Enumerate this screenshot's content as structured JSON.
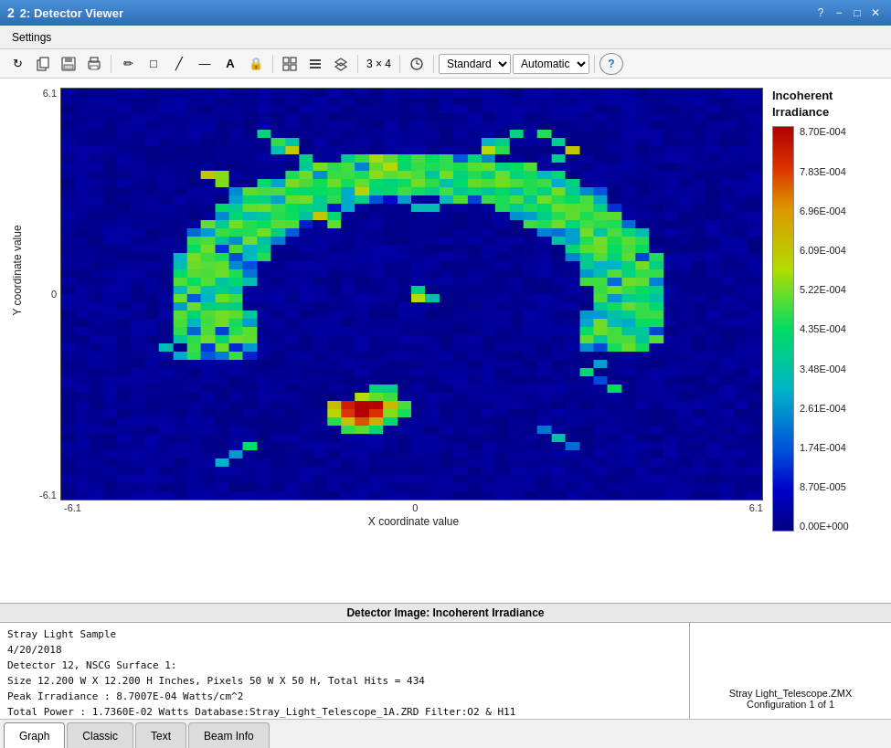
{
  "titlebar": {
    "icon": "2",
    "title": "2: Detector Viewer",
    "controls": {
      "minimize": "−",
      "maximize": "□",
      "close": "✕",
      "help": "?"
    }
  },
  "menu": {
    "items": [
      {
        "label": "Settings"
      }
    ]
  },
  "toolbar": {
    "refresh_label": "↻",
    "copy_label": "⎘",
    "save_label": "💾",
    "print_label": "🖨",
    "pencil_label": "✏",
    "rect_label": "□",
    "line_label": "/",
    "hline_label": "—",
    "text_label": "A",
    "lock_label": "🔒",
    "grid_label": "⊞",
    "layers_label": "≡",
    "stack_label": "⊕",
    "grid_size": "3 × 4",
    "clock_label": "⊙",
    "standard_label": "Standard ▼",
    "automatic_label": "Automatic ▼",
    "help_label": "?"
  },
  "chart": {
    "title": "Incoherent Irradiance",
    "y_axis_label": "Y coordinate value",
    "x_axis_label": "X coordinate value",
    "y_ticks": [
      "6.1",
      "0",
      "-6.1"
    ],
    "x_ticks": [
      "-6.1",
      "0",
      "6.1"
    ],
    "colorbar": {
      "title_line1": "Incoherent",
      "title_line2": "Irradiance",
      "labels": [
        "8.70E-004",
        "7.83E-004",
        "6.96E-004",
        "6.09E-004",
        "5.22E-004",
        "4.35E-004",
        "3.48E-004",
        "2.61E-004",
        "1.74E-004",
        "8.70E-005",
        "0.00E+000"
      ]
    }
  },
  "info_panel": {
    "title": "Detector Image: Incoherent Irradiance",
    "lines": [
      "Stray Light Sample",
      "4/20/2018",
      "Detector 12, NSCG Surface 1:",
      "Size 12.200 W X 12.200 H Inches, Pixels 50 W X 50 H, Total Hits = 434",
      "Peak Irradiance : 8.7007E-04 Watts/cm^2",
      "Total Power     : 1.7360E-02 Watts Database:Stray_Light_Telescope_1A.ZRD Filter:O2 & H11"
    ],
    "right_line1": "Stray Light_Telescope.ZMX",
    "right_line2": "Configuration 1 of 1"
  },
  "tabs": [
    {
      "label": "Graph",
      "active": true
    },
    {
      "label": "Classic",
      "active": false
    },
    {
      "label": "Text",
      "active": false
    },
    {
      "label": "Beam Info",
      "active": false
    }
  ]
}
